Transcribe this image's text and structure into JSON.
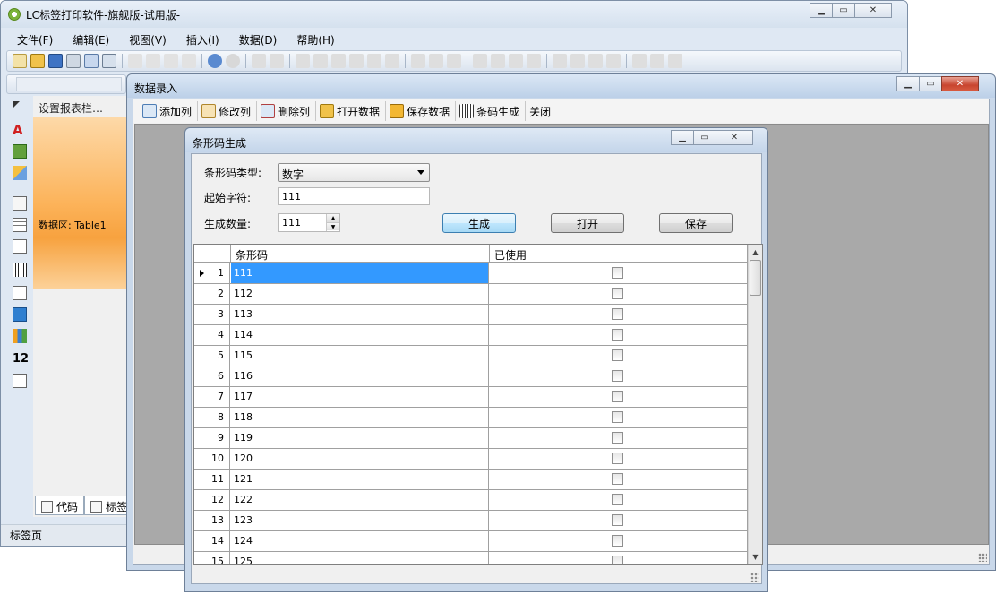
{
  "main": {
    "title": "LC标签打印软件-旗舰版-试用版-",
    "menu": [
      "文件(F)",
      "编辑(E)",
      "视图(V)",
      "插入(I)",
      "数据(D)",
      "帮助(H)"
    ],
    "panel_header": "设置报表栏…",
    "panel_data_label": "数据区: Table1",
    "bottom_tabs": [
      "代码",
      "标签"
    ],
    "status": "标签页"
  },
  "data_window": {
    "title": "数据录入",
    "toolbar": [
      "添加列",
      "修改列",
      "删除列",
      "打开数据",
      "保存数据",
      "条码生成",
      "关闭"
    ]
  },
  "barcode_dialog": {
    "title": "条形码生成",
    "type_label": "条形码类型:",
    "type_value": "数字",
    "start_label": "起始字符:",
    "start_value": "111",
    "count_label": "生成数量:",
    "count_value": "111",
    "generate_label": "生成",
    "open_label": "打开",
    "save_label": "保存",
    "columns": [
      "条形码",
      "已使用"
    ],
    "rows": [
      {
        "n": "1",
        "code": "111",
        "used": false
      },
      {
        "n": "2",
        "code": "112",
        "used": false
      },
      {
        "n": "3",
        "code": "113",
        "used": false
      },
      {
        "n": "4",
        "code": "114",
        "used": false
      },
      {
        "n": "5",
        "code": "115",
        "used": false
      },
      {
        "n": "6",
        "code": "116",
        "used": false
      },
      {
        "n": "7",
        "code": "117",
        "used": false
      },
      {
        "n": "8",
        "code": "118",
        "used": false
      },
      {
        "n": "9",
        "code": "119",
        "used": false
      },
      {
        "n": "10",
        "code": "120",
        "used": false
      },
      {
        "n": "11",
        "code": "121",
        "used": false
      },
      {
        "n": "12",
        "code": "122",
        "used": false
      },
      {
        "n": "13",
        "code": "123",
        "used": false
      },
      {
        "n": "14",
        "code": "124",
        "used": false
      },
      {
        "n": "15",
        "code": "125",
        "used": false
      }
    ]
  },
  "colors": {
    "selection": "#3399ff",
    "panel_orange": "#fcb35a",
    "workspace_gray": "#a9a9a9"
  }
}
